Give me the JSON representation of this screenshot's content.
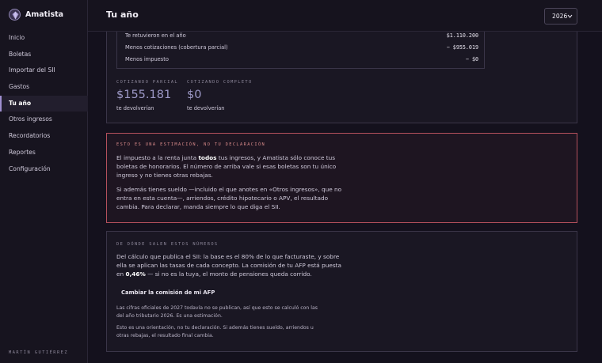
{
  "app": {
    "name": "Amatista"
  },
  "sidebar": {
    "items": [
      {
        "label": "Inicio",
        "name": "sidebar-item-inicio"
      },
      {
        "label": "Boletas",
        "name": "sidebar-item-boletas"
      },
      {
        "label": "Importar del SII",
        "name": "sidebar-item-importar"
      },
      {
        "label": "Gastos",
        "name": "sidebar-item-gastos"
      },
      {
        "label": "Tu año",
        "name": "sidebar-item-tu-ano",
        "active": true
      },
      {
        "label": "Otros ingresos",
        "name": "sidebar-item-otros-ingresos"
      },
      {
        "label": "Recordatorios",
        "name": "sidebar-item-recordatorios"
      },
      {
        "label": "Reportes",
        "name": "sidebar-item-reportes"
      },
      {
        "label": "Configuración",
        "name": "sidebar-item-configuracion"
      }
    ],
    "footer": "MARTÍN GUTIÉRREZ"
  },
  "header": {
    "title": "Tu año",
    "year": "2026"
  },
  "summary": {
    "rows": [
      {
        "label": "Te retuvieron en el año",
        "value": "$1.110.200"
      },
      {
        "label": "Menos cotizaciones (cobertura parcial)",
        "value": "− $955.019"
      },
      {
        "label": "Menos impuesto",
        "value": "− $0"
      }
    ],
    "partial": {
      "kicker": "COTIZANDO PARCIAL",
      "amount": "$155.181",
      "caption": "te devolverían"
    },
    "complete": {
      "kicker": "COTIZANDO COMPLETO",
      "amount": "$0",
      "caption": "te devolverían"
    }
  },
  "warning": {
    "kicker": "ESTO ES UNA ESTIMACIÓN, NO TU DECLARACIÓN",
    "p1_before": "El impuesto a la renta junta ",
    "p1_bold": "todos",
    "p1_after": " tus ingresos, y Amatista sólo conoce tus boletas de honorarios. El número de arriba vale si esas boletas son tu único ingreso y no tienes otras rebajas.",
    "p2": "Si además tienes sueldo —incluido el que anotes en «Otros ingresos», que no entra en esta cuenta—, arriendos, crédito hipotecario o APV, el resultado cambia. Para declarar, manda siempre lo que diga el SII."
  },
  "source": {
    "kicker": "DE DÓNDE SALEN ESTOS NÚMEROS",
    "p1_before": "Del cálculo que publica el SII: la base es el 80% de lo que facturaste, y sobre ella se aplican las tasas de cada concepto. La comisión de tu AFP está puesta en ",
    "p1_bold": "0,46%",
    "p1_after": " — si no es la tuya, el monto de pensiones queda corrido.",
    "button": "Cambiar la comisión de mi AFP",
    "note1": "Las cifras oficiales de 2027 todavía no se publican, así que esto se calculó con las del año tributario 2026. Es una estimación.",
    "note2": "Esto es una orientación, no tu declaración. Si además tienes sueldo, arriendos u otras rebajas, el resultado final cambia."
  },
  "colors": {
    "accent": "#9c98c6",
    "warning_border": "#b4505c",
    "warning_text": "#d98a8a"
  }
}
